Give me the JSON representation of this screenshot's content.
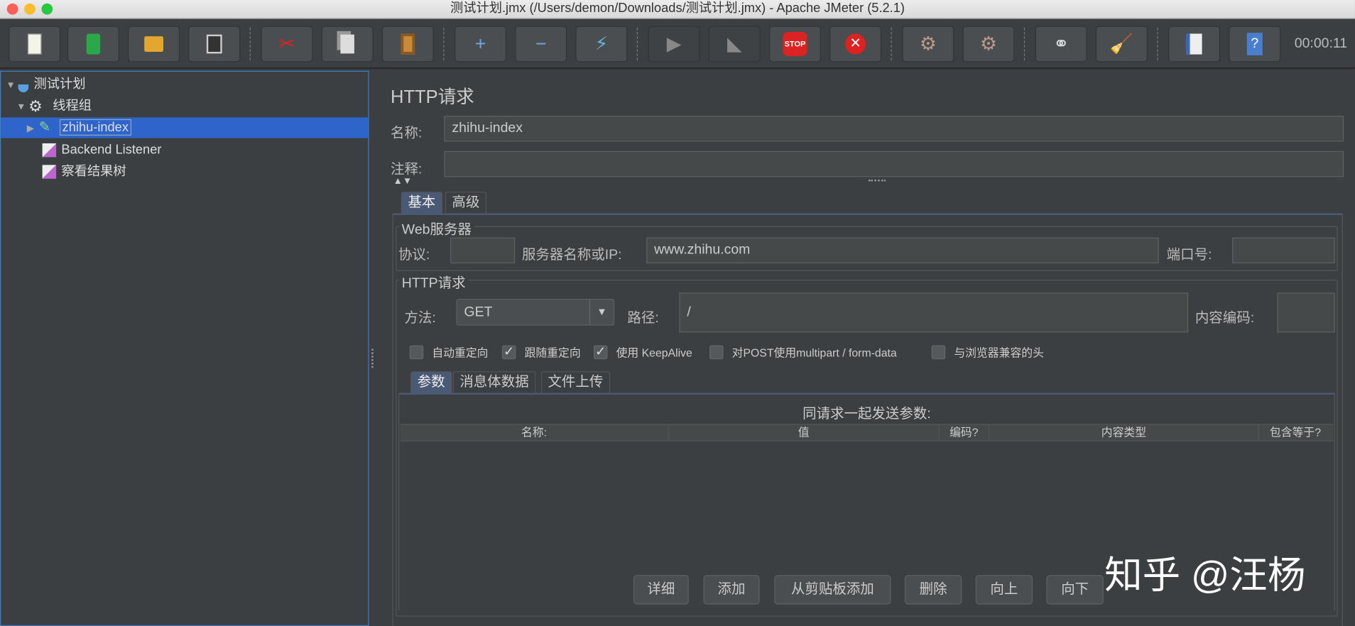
{
  "window": {
    "title": "测试计划.jmx (/Users/demon/Downloads/测试计划.jmx) - Apache JMeter (5.2.1)"
  },
  "toolbar": {
    "timer": "00:00:11",
    "buttons": [
      "new-icon",
      "templates-icon",
      "open-icon",
      "save-icon",
      "cut-icon",
      "copy-icon",
      "paste-icon",
      "expand-icon",
      "collapse-icon",
      "toggle-icon",
      "start-icon",
      "start-no-pause-icon",
      "stop-icon",
      "shutdown-icon",
      "clear-icon",
      "clear-all-icon",
      "search-icon",
      "reset-search-icon",
      "function-helper-icon",
      "help-icon"
    ]
  },
  "tree": {
    "items": [
      {
        "label": "测试计划"
      },
      {
        "label": "线程组"
      },
      {
        "label": "zhihu-index"
      },
      {
        "label": "Backend Listener"
      },
      {
        "label": "察看结果树"
      }
    ]
  },
  "main": {
    "title": "HTTP请求",
    "name_label": "名称:",
    "name_value": "zhihu-index",
    "comment_label": "注释:",
    "comment_value": "",
    "tabs": [
      "基本",
      "高级"
    ],
    "web_server": {
      "title": "Web服务器",
      "protocol_label": "协议:",
      "protocol_value": "",
      "server_label": "服务器名称或IP:",
      "server_value": "www.zhihu.com",
      "port_label": "端口号:",
      "port_value": ""
    },
    "http_request": {
      "title": "HTTP请求",
      "method_label": "方法:",
      "method_value": "GET",
      "path_label": "路径:",
      "path_value": "/",
      "encoding_label": "内容编码:",
      "encoding_value": ""
    },
    "checkboxes": [
      {
        "label": "自动重定向",
        "checked": false
      },
      {
        "label": "跟随重定向",
        "checked": true
      },
      {
        "label": "使用 KeepAlive",
        "checked": true
      },
      {
        "label": "对POST使用multipart / form-data",
        "checked": false
      },
      {
        "label": "与浏览器兼容的头",
        "checked": false
      }
    ],
    "sub_tabs": [
      "参数",
      "消息体数据",
      "文件上传"
    ],
    "params_title": "同请求一起发送参数:",
    "columns": [
      "名称:",
      "值",
      "编码?",
      "内容类型",
      "包含等于?"
    ],
    "buttons": [
      "详细",
      "添加",
      "从剪贴板添加",
      "删除",
      "向上",
      "向下"
    ]
  },
  "watermark": "知乎 @汪杨"
}
